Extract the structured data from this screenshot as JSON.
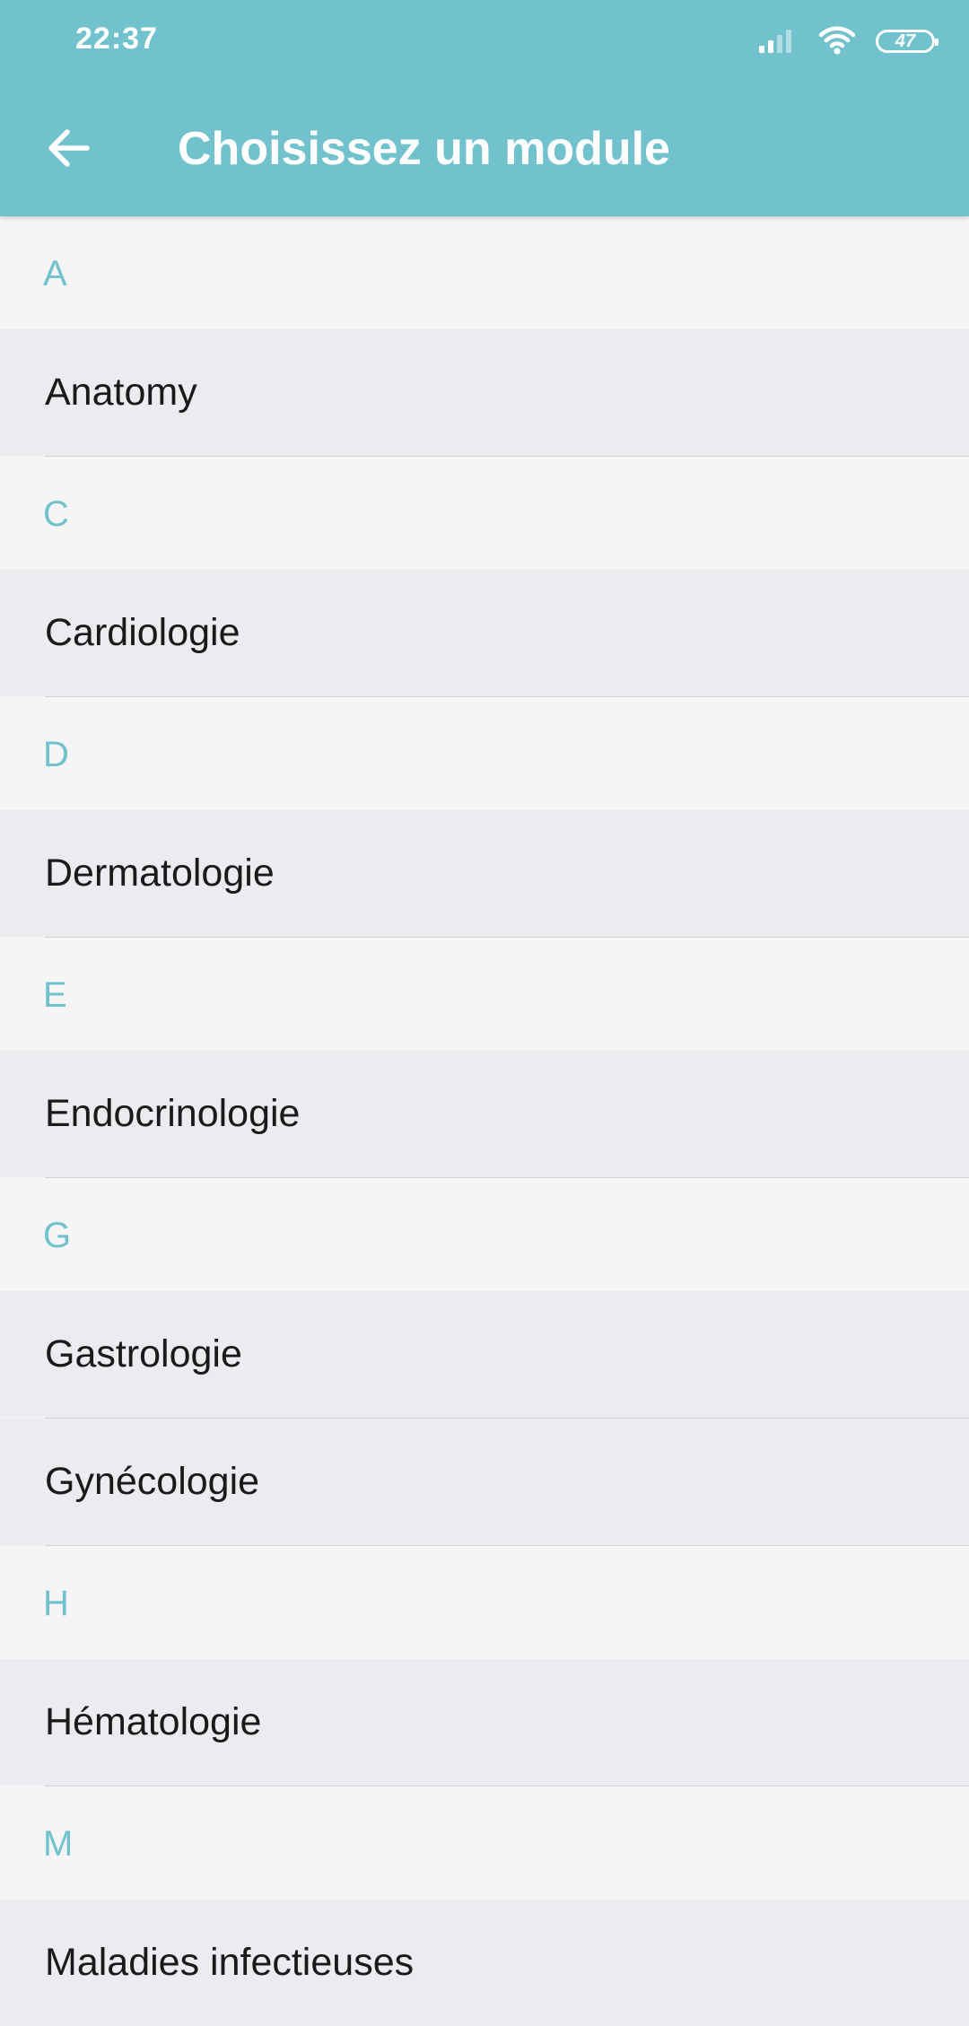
{
  "status_bar": {
    "time": "22:37",
    "battery": "47",
    "icons": [
      "signal-icon",
      "wifi-icon",
      "battery-icon"
    ]
  },
  "app_bar": {
    "back_icon": "arrow-left-icon",
    "title": "Choisissez un module"
  },
  "colors": {
    "accent": "#72c2ce",
    "section_bg": "#f5f5f5",
    "item_bg": "#ebebf0",
    "text": "#1a1a1a"
  },
  "sections": [
    {
      "letter": "A",
      "items": [
        "Anatomy"
      ]
    },
    {
      "letter": "C",
      "items": [
        "Cardiologie"
      ]
    },
    {
      "letter": "D",
      "items": [
        "Dermatologie"
      ]
    },
    {
      "letter": "E",
      "items": [
        "Endocrinologie"
      ]
    },
    {
      "letter": "G",
      "items": [
        "Gastrologie",
        "Gynécologie"
      ]
    },
    {
      "letter": "H",
      "items": [
        "Hématologie"
      ]
    },
    {
      "letter": "M",
      "items": [
        "Maladies infectieuses"
      ]
    }
  ]
}
